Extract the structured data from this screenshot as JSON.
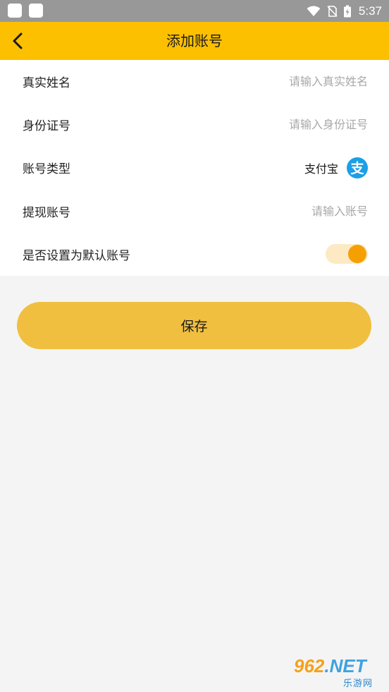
{
  "status_bar": {
    "time": "5:37"
  },
  "app_bar": {
    "title": "添加账号",
    "back_icon": "chevron-left-icon"
  },
  "form": {
    "real_name": {
      "label": "真实姓名",
      "value": "",
      "placeholder": "请输入真实姓名"
    },
    "id_number": {
      "label": "身份证号",
      "value": "",
      "placeholder": "请输入身份证号"
    },
    "account_type": {
      "label": "账号类型",
      "value": "支付宝",
      "icon": "alipay-icon",
      "icon_glyph": "支"
    },
    "withdraw_account": {
      "label": "提现账号",
      "value": "",
      "placeholder": "请输入账号"
    },
    "set_default": {
      "label": "是否设置为默认账号",
      "enabled": true
    }
  },
  "save_button": {
    "label": "保存"
  },
  "watermark": {
    "number": "962",
    "suffix": ".NET",
    "tagline": "乐游网"
  },
  "colors": {
    "accent": "#fcc000",
    "button": "#f0bf40",
    "toggle_knob": "#f5a000",
    "toggle_track": "#fde9c4",
    "alipay": "#1b9fe6",
    "page_bg": "#f4f4f4"
  }
}
